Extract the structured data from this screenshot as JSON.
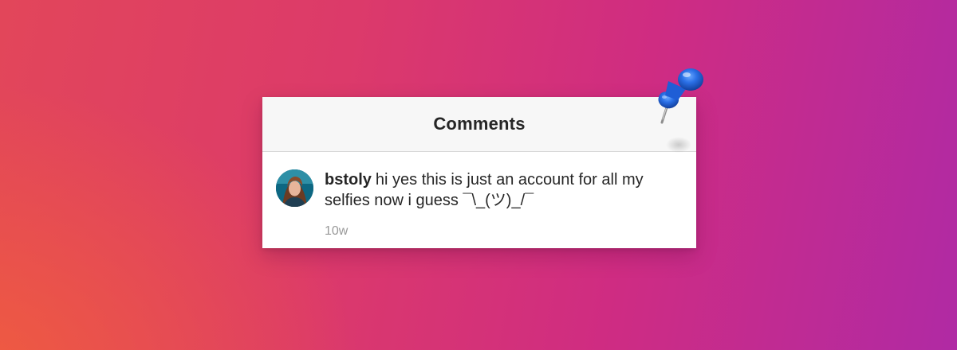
{
  "header": {
    "title": "Comments"
  },
  "comment": {
    "username": "bstoly",
    "text": "hi yes this is just an account for all my selfies now i guess ¯\\_(ツ)_/¯",
    "timestamp": "10w"
  },
  "icons": {
    "avatar": "user-avatar-photo",
    "pin": "pushpin-icon"
  },
  "colors": {
    "background_start": "#e2465a",
    "background_end": "#b02aa4",
    "pin_blue": "#1f63d8",
    "timestamp_gray": "#999999"
  }
}
